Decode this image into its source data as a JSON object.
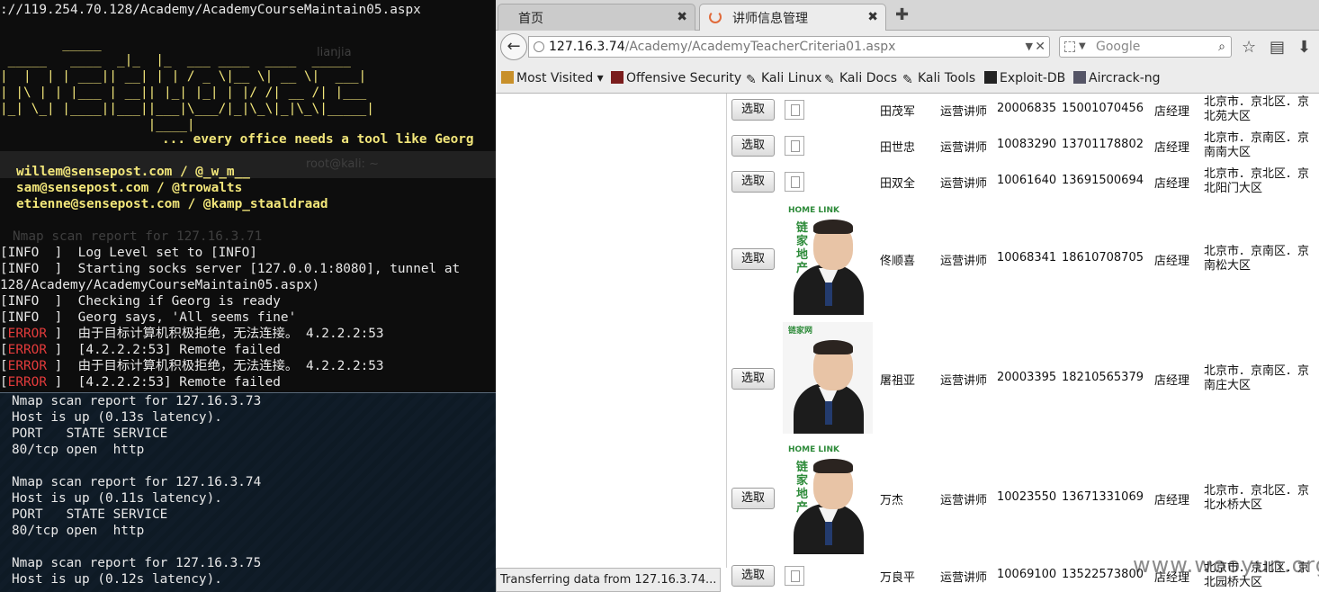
{
  "terminal": {
    "url_line": "://119.254.70.128/Academy/AcademyCourseMaintain05.aspx",
    "banner_lines": [
      "        _____",
      " _____   ____  _|_  |_  ___ ____  ____  _____",
      "|  |  | | ___|| __| | | / _ \\|__ \\| __ \\|  ___|",
      "| |\\ | | |___ | __|| |_| |_| | |/ /| __ /| |___",
      "|_| \\_| |____||___||___|\\___/|_|\\_\\|_|\\_\\|_____|",
      "                   |____|"
    ],
    "tagline": "... every office needs a tool like Georg",
    "ghost_title": "lianjia",
    "ghost_prompt": "root@kali: ~",
    "credits": [
      "willem@sensepost.com / @_w_m__",
      "sam@sensepost.com / @trowalts",
      "etienne@sensepost.com / @kamp_staaldraad"
    ],
    "ghost_nmap": "Nmap scan report for 127.16.3.71",
    "log": [
      {
        "tag": "INFO",
        "text": "Log Level set to [INFO]"
      },
      {
        "tag": "INFO",
        "text": "Starting socks server [127.0.0.1:8080], tunnel at"
      },
      {
        "tag": "",
        "text": "128/Academy/AcademyCourseMaintain05.aspx)"
      },
      {
        "tag": "INFO",
        "text": "Checking if Georg is ready"
      },
      {
        "tag": "INFO",
        "text": "Georg says, 'All seems fine'"
      },
      {
        "tag": "ERROR",
        "text": "由于目标计算机积极拒绝，无法连接。 4.2.2.2:53"
      },
      {
        "tag": "ERROR",
        "text": "[4.2.2.2:53] Remote failed"
      },
      {
        "tag": "ERROR",
        "text": "由于目标计算机积极拒绝，无法连接。 4.2.2.2:53"
      },
      {
        "tag": "ERROR",
        "text": "[4.2.2.2:53] Remote failed"
      }
    ],
    "nmap": [
      "Nmap scan report for 127.16.3.73",
      "Host is up (0.13s latency).",
      "PORT   STATE SERVICE",
      "80/tcp open  http",
      "",
      "Nmap scan report for 127.16.3.74",
      "Host is up (0.11s latency).",
      "PORT   STATE SERVICE",
      "80/tcp open  http",
      "",
      "Nmap scan report for 127.16.3.75",
      "Host is up (0.12s latency)."
    ]
  },
  "browser": {
    "tabs": [
      {
        "label": "首页"
      },
      {
        "label": "讲师信息管理"
      }
    ],
    "url_host": "127.16.3.74",
    "url_path": "/Academy/AcademyTeacherCriteria01.aspx",
    "search_placeholder": "Google",
    "bookmarks": [
      "Most Visited",
      "Offensive Security",
      "Kali Linux",
      "Kali Docs",
      "Kali Tools",
      "Exploit-DB",
      "Aircrack-ng"
    ],
    "select_label": "选取",
    "rows": [
      {
        "name": "田茂军",
        "role": "运营讲师",
        "id": "20006835",
        "phone": "15001070456",
        "title": "店经理",
        "addr": "北京市．京北区．京北苑大区",
        "photo": false
      },
      {
        "name": "田世忠",
        "role": "运营讲师",
        "id": "10083290",
        "phone": "13701178802",
        "title": "店经理",
        "addr": "北京市．京南区．京南南大区",
        "photo": false
      },
      {
        "name": "田双全",
        "role": "运营讲师",
        "id": "10061640",
        "phone": "13691500694",
        "title": "店经理",
        "addr": "北京市．京北区．京北阳门大区",
        "photo": false
      },
      {
        "name": "佟顺喜",
        "role": "运营讲师",
        "id": "10068341",
        "phone": "18610708705",
        "title": "店经理",
        "addr": "北京市．京南区．京南松大区",
        "photo": true
      },
      {
        "name": "屠祖亚",
        "role": "运营讲师",
        "id": "20003395",
        "phone": "18210565379",
        "title": "店经理",
        "addr": "北京市．京南区．京南庄大区",
        "photo": true
      },
      {
        "name": "万杰",
        "role": "运营讲师",
        "id": "10023550",
        "phone": "13671331069",
        "title": "店经理",
        "addr": "北京市．京北区．京北水桥大区",
        "photo": true
      },
      {
        "name": "万良平",
        "role": "运营讲师",
        "id": "10069100",
        "phone": "13522573800",
        "title": "店经理",
        "addr": "北京市．京北区．京北园桥大区",
        "photo": false
      }
    ],
    "photo_logo_top": "HOME LINK",
    "photo_logo_side": "链家地产",
    "photo_logo_small": "链家网",
    "status": "Transferring data from 127.16.3.74...",
    "watermark": "www.wooyun.org"
  }
}
